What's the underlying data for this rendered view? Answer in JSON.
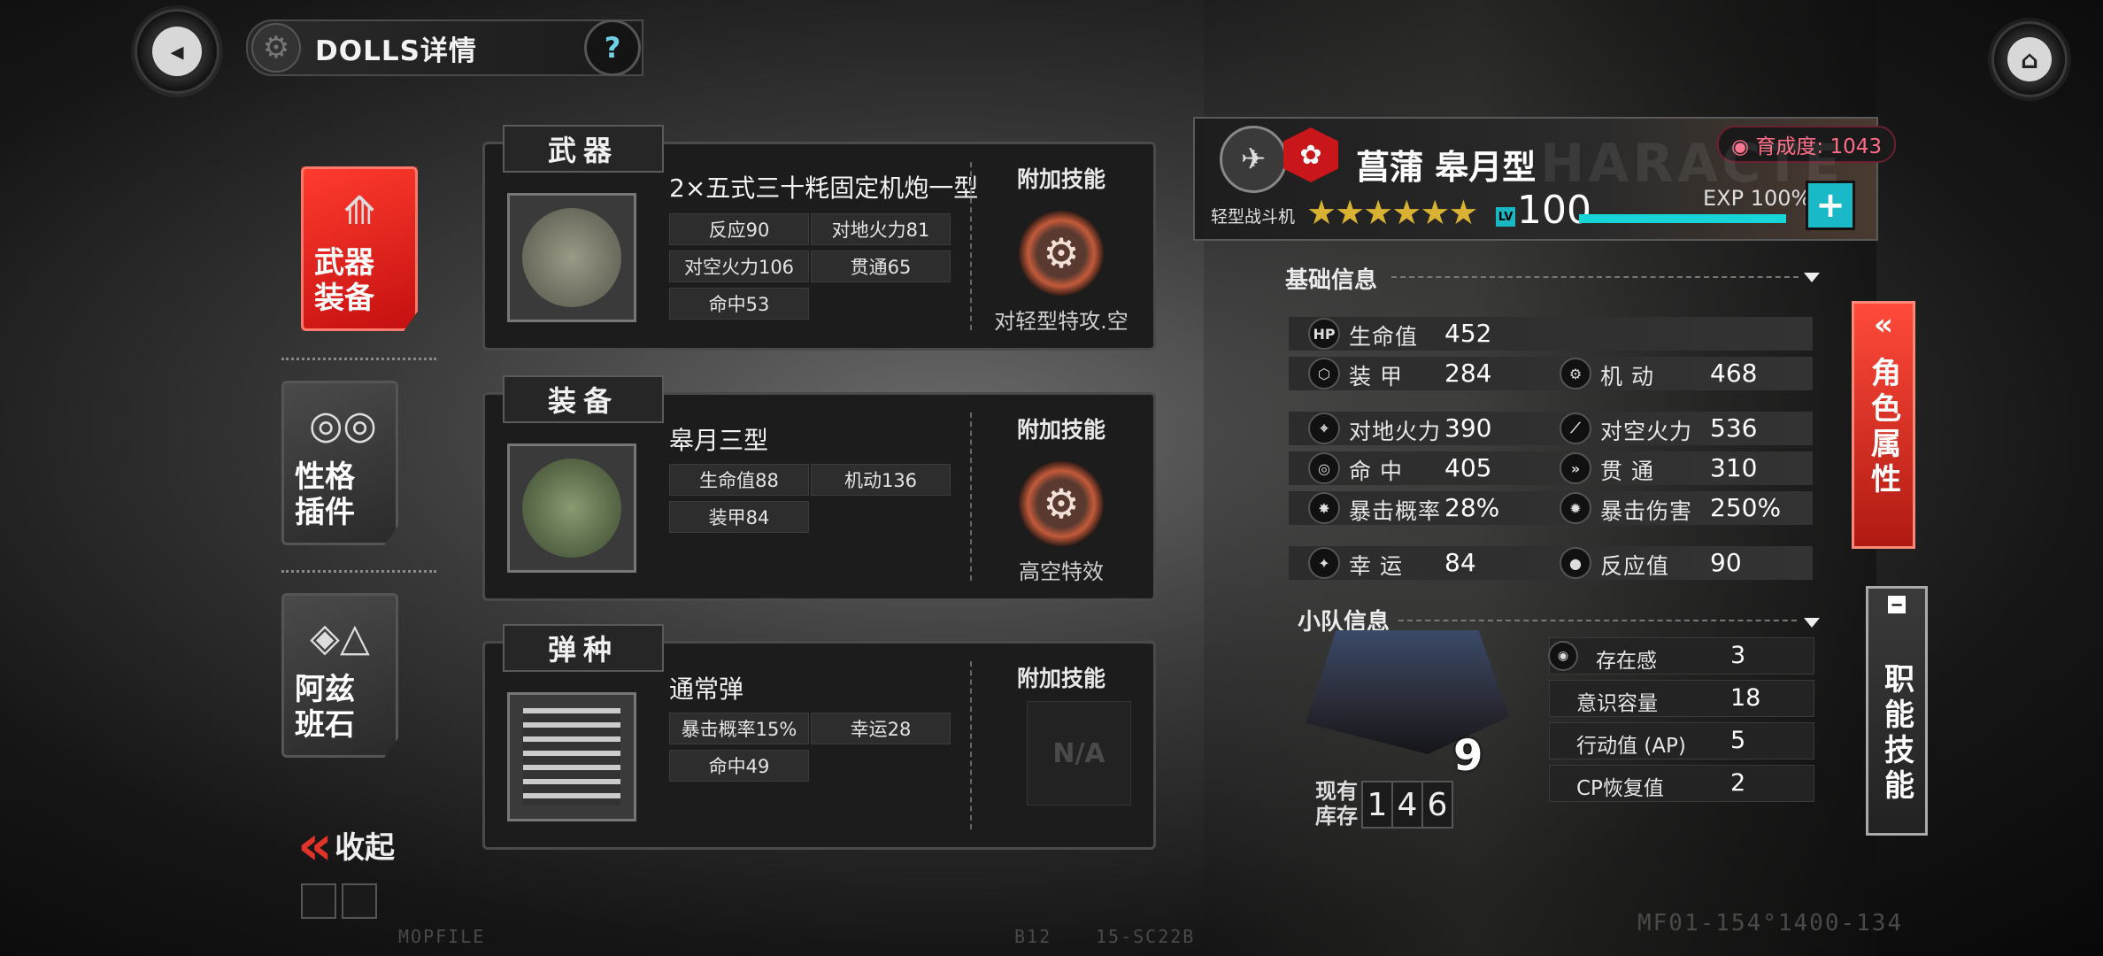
{
  "header": {
    "title": "DOLLS详情",
    "help_label": "?"
  },
  "left_tabs": [
    {
      "label_line1": "武器",
      "label_line2": "装备"
    },
    {
      "label_line1": "性格",
      "label_line2": "插件"
    },
    {
      "label_line1": "阿兹",
      "label_line2": "班石"
    }
  ],
  "collapse_label": "收起",
  "cards": {
    "weapon": {
      "header": "武器",
      "name": "2×五式三十粍固定机炮一型",
      "stats": [
        "反应90",
        "对地火力81",
        "对空火力106",
        "贯通65",
        "命中53"
      ],
      "skill_title": "附加技能",
      "skill_text": "对轻型特攻.空"
    },
    "equipment": {
      "header": "装备",
      "name": "皋月三型",
      "stats": [
        "生命值88",
        "机动136",
        "装甲84"
      ],
      "skill_title": "附加技能",
      "skill_text": "高空特效"
    },
    "ammo": {
      "header": "弹种",
      "name": "通常弹",
      "stats": [
        "暴击概率15%",
        "幸运28",
        "命中49"
      ],
      "skill_title": "附加技能",
      "skill_na": "N/A"
    }
  },
  "character": {
    "name": "菖蒲 皋月型",
    "class": "轻型战斗机",
    "stars": "★★★★★★",
    "lv_badge": "LV",
    "level": "100",
    "exp": "EXP 100%",
    "exp_percent": 100,
    "growth": "育成度: 1043",
    "watermark": "HARACTE",
    "plus_label": "+"
  },
  "basic_info": {
    "title": "基础信息",
    "stats": [
      {
        "icon": "HP",
        "label": "生命值",
        "value": "452"
      },
      {
        "icon": "⬡",
        "label": "装 甲",
        "value": "284"
      },
      {
        "icon": "⚙",
        "label": "机 动",
        "value": "468"
      },
      {
        "icon": "⌖",
        "label": "对地火力",
        "value": "390"
      },
      {
        "icon": "⟋",
        "label": "对空火力",
        "value": "536"
      },
      {
        "icon": "◎",
        "label": "命 中",
        "value": "405"
      },
      {
        "icon": "»",
        "label": "贯 通",
        "value": "310"
      },
      {
        "icon": "✸",
        "label": "暴击概率",
        "value": "28%"
      },
      {
        "icon": "✹",
        "label": "暴击伤害",
        "value": "250%"
      },
      {
        "icon": "✦",
        "label": "幸 运",
        "value": "84"
      },
      {
        "icon": "●",
        "label": "反应值",
        "value": "90"
      }
    ]
  },
  "squad_info": {
    "title": "小队信息",
    "count": "9",
    "stock_label_1": "现有",
    "stock_label_2": "库存",
    "stock_digits": [
      "1",
      "4",
      "6"
    ],
    "stats": [
      {
        "label": "存在感",
        "value": "3"
      },
      {
        "label": "意识容量",
        "value": "18"
      },
      {
        "label": "行动值 (AP)",
        "value": "5"
      },
      {
        "label": "CP恢复值",
        "value": "2"
      }
    ]
  },
  "side_tabs": {
    "attributes": "角色属性",
    "skills": "职能技能",
    "minus": "−"
  },
  "footer": {
    "left": "MOPFILE",
    "mid1": "B12",
    "mid2": "15-SC22B",
    "right": "MF01-154°1400-134"
  },
  "colors": {
    "accent_red": "#e0332a",
    "accent_cyan": "#17d4d6",
    "star_gold": "#d9b233",
    "growth_pink": "#ff6c88"
  }
}
